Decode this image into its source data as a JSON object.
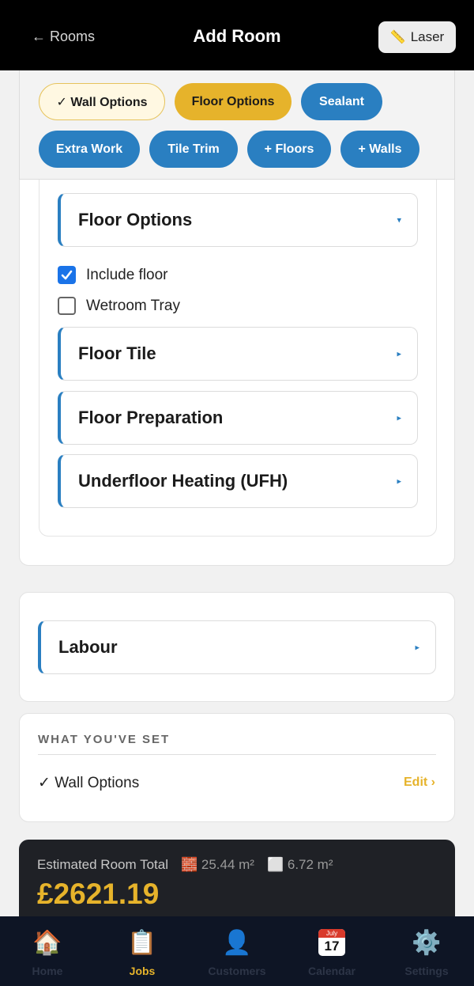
{
  "header": {
    "back_label": "← Rooms",
    "title": "Add Room",
    "laser_icon": "ruler-icon",
    "laser_label": "Laser"
  },
  "chips": [
    {
      "label": "✓ Wall Options",
      "state": "done"
    },
    {
      "label": "Floor Options",
      "state": "active"
    },
    {
      "label": "Sealant",
      "state": "default"
    },
    {
      "label": "Extra Work",
      "state": "default"
    },
    {
      "label": "Tile Trim",
      "state": "default"
    },
    {
      "label": "+ Floors",
      "state": "default"
    },
    {
      "label": "+ Walls",
      "state": "default"
    }
  ],
  "floor_options": {
    "heading": "Floor Options",
    "heading_arrow": "▾",
    "checkboxes": [
      {
        "label": "Include floor",
        "checked": true
      },
      {
        "label": "Wetroom Tray",
        "checked": false
      }
    ],
    "sections": [
      {
        "label": "Floor Tile",
        "arrow": "▸"
      },
      {
        "label": "Floor Preparation",
        "arrow": "▸"
      },
      {
        "label": "Underfloor Heating (UFH)",
        "arrow": "▸"
      }
    ]
  },
  "labour": {
    "label": "Labour",
    "arrow": "▸"
  },
  "summary": {
    "heading": "WHAT YOU'VE SET",
    "items": [
      {
        "label": "✓ Wall Options",
        "action": "Edit ›"
      }
    ]
  },
  "total": {
    "label": "Estimated Room Total",
    "wall_area": "🧱 25.44 m²",
    "floor_area": "⬜ 6.72 m²",
    "value": "£2621.19"
  },
  "nav": [
    {
      "label": "Home",
      "icon": "🏠",
      "icon_name": "home-icon",
      "active": false
    },
    {
      "label": "Jobs",
      "icon": "📋",
      "icon_name": "clipboard-icon",
      "active": true
    },
    {
      "label": "Customers",
      "icon": "👤",
      "icon_name": "person-icon",
      "active": false
    },
    {
      "label": "Calendar",
      "icon_name": "calendar-icon",
      "cal_month": "July",
      "cal_day": "17",
      "active": false
    },
    {
      "label": "Settings",
      "icon": "⚙️",
      "icon_name": "gear-icon",
      "active": false
    }
  ],
  "colors": {
    "accent_blue": "#2a7fc1",
    "accent_gold": "#e6b32b",
    "topbar": "#000000",
    "nav_bg": "#0e1525"
  }
}
